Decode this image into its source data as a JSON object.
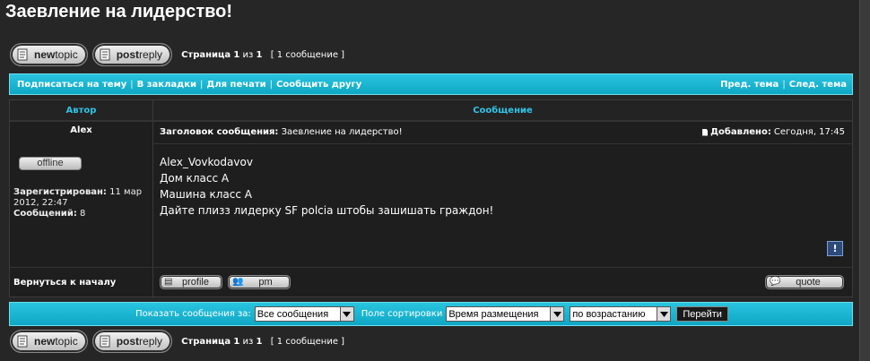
{
  "page_title": "Заевление на лидерство!",
  "buttons": {
    "new_topic": {
      "part1": "new",
      "part2": "topic"
    },
    "post_reply": {
      "part1": "post",
      "part2": "reply"
    }
  },
  "pagination": {
    "label": "Страница",
    "current": "1",
    "of": "из",
    "total": "1",
    "count": "[ 1 сообщение ]"
  },
  "topbar": {
    "links": [
      "Подписаться на тему",
      "В закладки",
      "Для печати",
      "Сообщить другу"
    ],
    "prev_topic": "Пред. тема",
    "next_topic": "След. тема"
  },
  "table": {
    "col_author": "Автор",
    "col_message": "Сообщение"
  },
  "post": {
    "author": "Alex",
    "subject_label": "Заголовок сообщения:",
    "subject": "Заевление на лидерство!",
    "added_label": "Добавлено:",
    "added_time": "Сегодня, 17:45",
    "status": "offline",
    "registered_label": "Зарегистрирован:",
    "registered_value": "11 мар 2012, 22:47",
    "posts_label": "Сообщений:",
    "posts_value": "8",
    "message_lines": [
      "Alex_Vovkodavov",
      "Дом класс А",
      "Машина класс А",
      "Дайте плизз лидерку SF polcia штобы зашишать граждон!"
    ],
    "report_icon": "!",
    "back_to_top": "Вернуться к началу",
    "profile_btn": "profile",
    "pm_btn": "pm",
    "quote_btn": "quote"
  },
  "sortbar": {
    "show_label": "Показать сообщения за:",
    "show_value": "Все сообщения",
    "sort_label": "Поле сортировки",
    "sort_value": "Время размещения",
    "order_value": "по возрастанию",
    "go_label": "Перейти"
  },
  "colors": {
    "accent": "#17b3d1",
    "header_text": "#2fc4e6",
    "background": "#262626"
  }
}
